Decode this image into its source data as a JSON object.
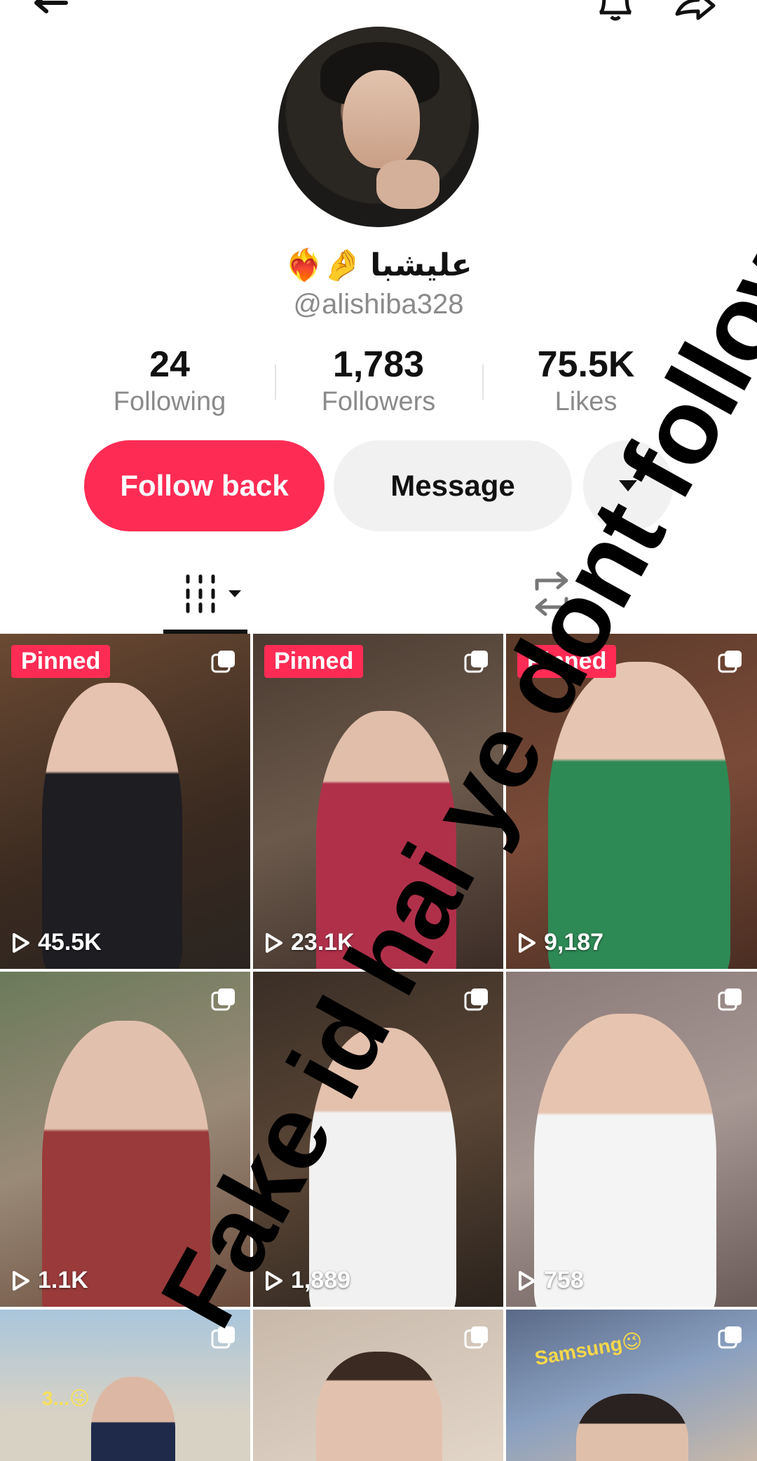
{
  "header": {
    "back_icon": "back-arrow-icon",
    "bell_icon": "bell-icon",
    "share_icon": "share-icon"
  },
  "profile": {
    "display_name": "عليشبا",
    "name_emoji": "❤️‍🔥🤌",
    "handle": "@alishiba328"
  },
  "stats": {
    "following": {
      "value": "24",
      "label": "Following"
    },
    "followers": {
      "value": "1,783",
      "label": "Followers"
    },
    "likes": {
      "value": "75.5K",
      "label": "Likes"
    }
  },
  "actions": {
    "follow_back": "Follow back",
    "message": "Message"
  },
  "tabs": {
    "videos_icon": "videos-grid-icon",
    "reposts_icon": "repost-icon"
  },
  "videos": [
    {
      "pinned": "Pinned",
      "views": "45.5K"
    },
    {
      "pinned": "Pinned",
      "views": "23.1K"
    },
    {
      "pinned": "Pinned",
      "views": "9,187"
    },
    {
      "pinned": "",
      "views": "1.1K"
    },
    {
      "pinned": "",
      "views": "1,889"
    },
    {
      "pinned": "",
      "views": "758"
    },
    {
      "pinned": "",
      "views": "",
      "caption": "3...😜"
    },
    {
      "pinned": "",
      "views": ""
    },
    {
      "pinned": "",
      "views": "",
      "caption": "Samsung😉"
    }
  ],
  "overlay_text": "Fake id hai ye dont follow",
  "colors": {
    "accent": "#fe2c55",
    "muted_text": "#8a8a8a",
    "button_gray": "#f1f1f1"
  }
}
